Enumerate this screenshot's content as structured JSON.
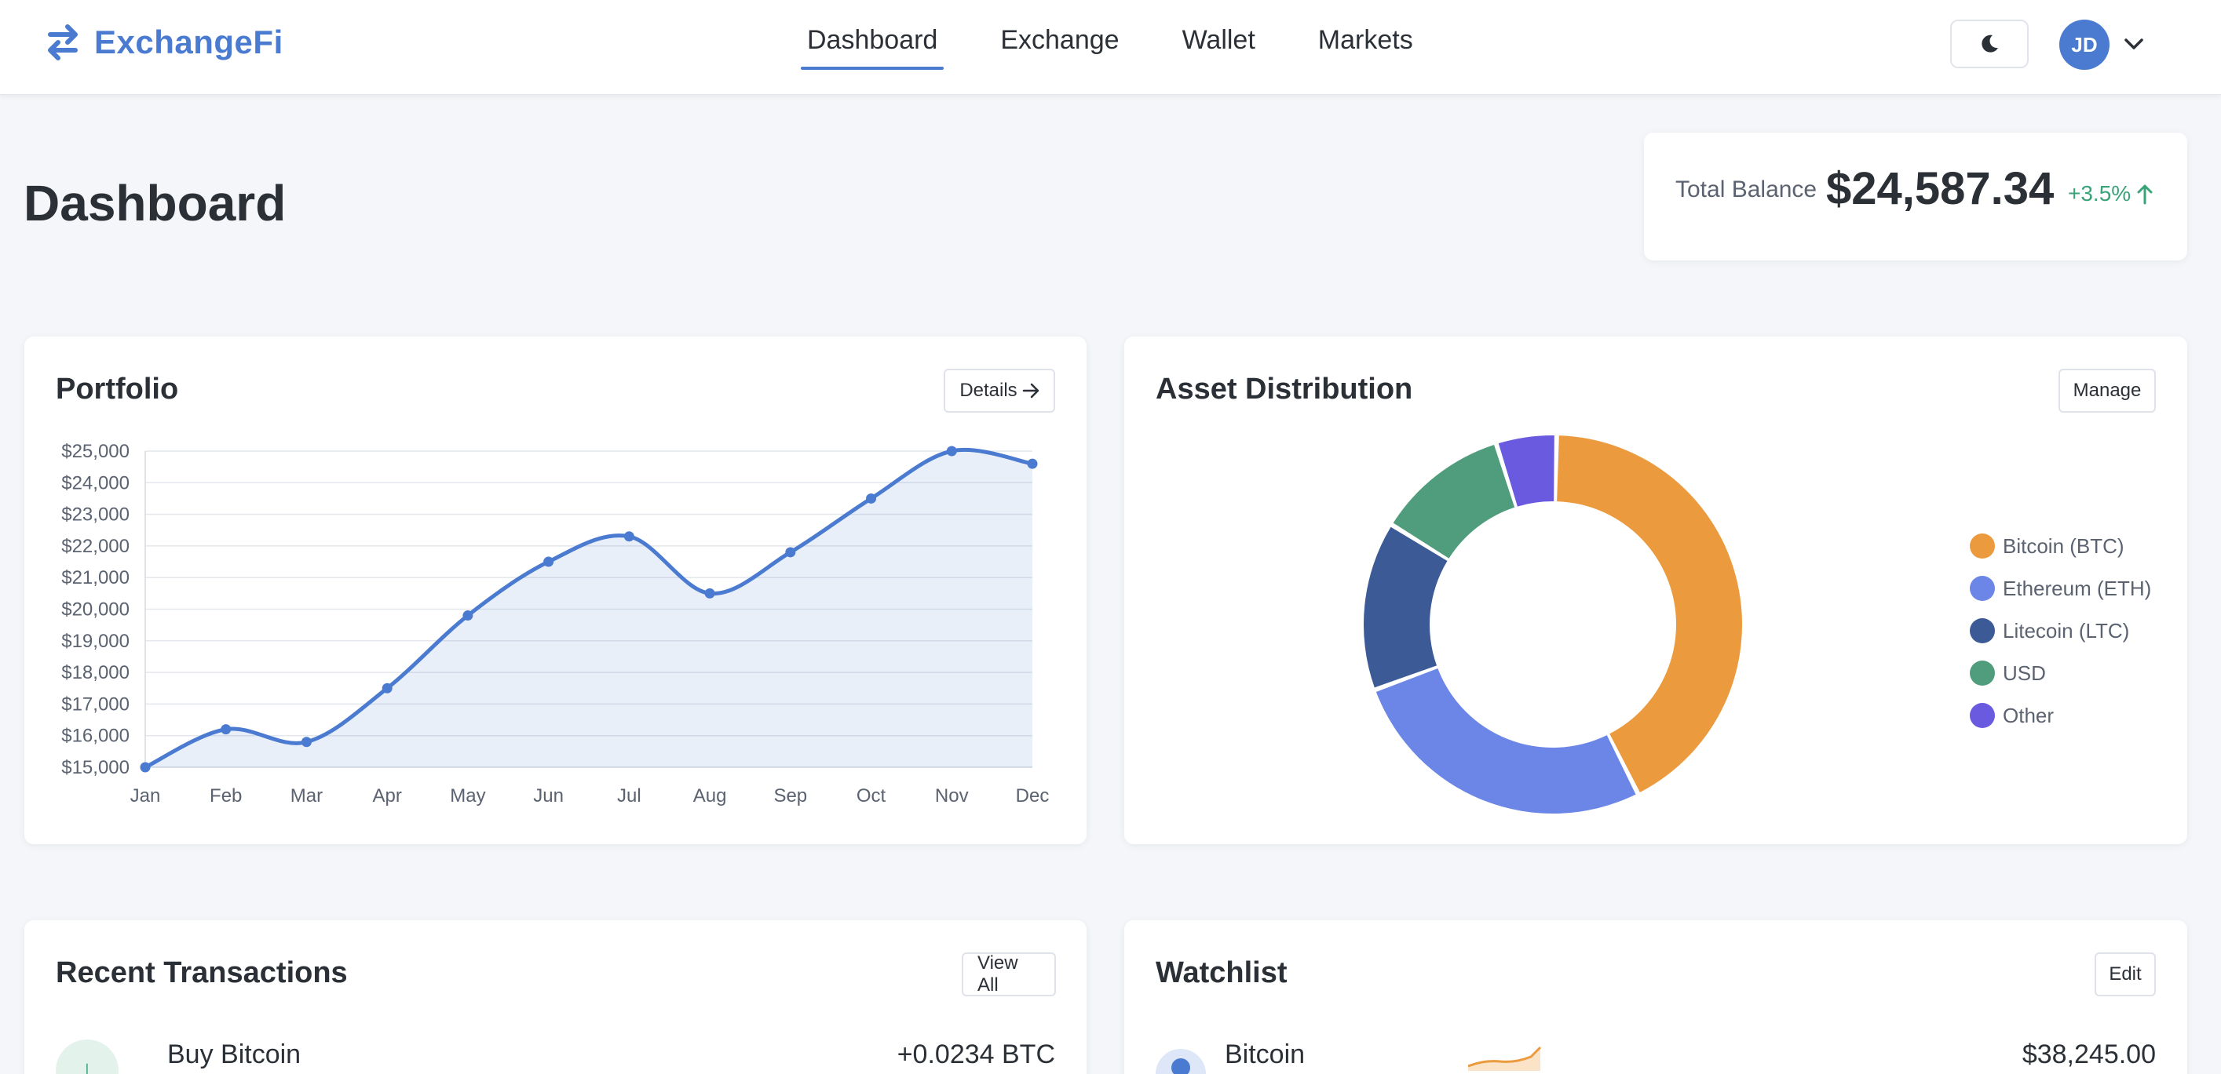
{
  "app": {
    "name": "ExchangeFi"
  },
  "nav": {
    "items": [
      "Dashboard",
      "Exchange",
      "Wallet",
      "Markets"
    ],
    "active": "Dashboard"
  },
  "user": {
    "initials": "JD"
  },
  "page": {
    "title": "Dashboard"
  },
  "balance": {
    "label": "Total Balance",
    "value": "$24,587.34",
    "change": "+3.5%"
  },
  "portfolio": {
    "title": "Portfolio",
    "button_label": "Details"
  },
  "assets": {
    "title": "Asset Distribution",
    "button_label": "Manage",
    "legend": [
      {
        "label": "Bitcoin (BTC)",
        "color": "#ec9a3e"
      },
      {
        "label": "Ethereum (ETH)",
        "color": "#6b86e6"
      },
      {
        "label": "Litecoin (LTC)",
        "color": "#3b5a96"
      },
      {
        "label": "USD",
        "color": "#4f9d7c"
      },
      {
        "label": "Other",
        "color": "#6a5ae0"
      }
    ]
  },
  "transactions": {
    "title": "Recent Transactions",
    "button_label": "View All",
    "items": [
      {
        "name": "Buy Bitcoin",
        "amount": "+0.0234 BTC"
      }
    ]
  },
  "watchlist": {
    "title": "Watchlist",
    "button_label": "Edit",
    "items": [
      {
        "name": "Bitcoin",
        "price": "$38,245.00"
      }
    ]
  },
  "colors": {
    "accent": "#4a7bd0",
    "positive": "#3aa37a"
  },
  "chart_data": [
    {
      "type": "area",
      "categories": [
        "Jan",
        "Feb",
        "Mar",
        "Apr",
        "May",
        "Jun",
        "Jul",
        "Aug",
        "Sep",
        "Oct",
        "Nov",
        "Dec"
      ],
      "series": [
        {
          "values": [
            15000,
            16200,
            15800,
            17500,
            19800,
            21500,
            22300,
            20500,
            21800,
            23500,
            25000,
            24600
          ],
          "color": "#4a7bd0"
        }
      ],
      "y_ticks": [
        "$15,000",
        "$16,000",
        "$17,000",
        "$18,000",
        "$19,000",
        "$20,000",
        "$21,000",
        "$22,000",
        "$23,000",
        "$24,000",
        "$25,000"
      ],
      "ylim": [
        15000,
        25000
      ],
      "grid": true
    },
    {
      "type": "pie",
      "categories": [
        "Bitcoin (BTC)",
        "Ethereum (ETH)",
        "Litecoin (LTC)",
        "USD",
        "Other"
      ],
      "values": [
        41,
        26,
        14,
        11,
        5
      ]
    }
  ]
}
